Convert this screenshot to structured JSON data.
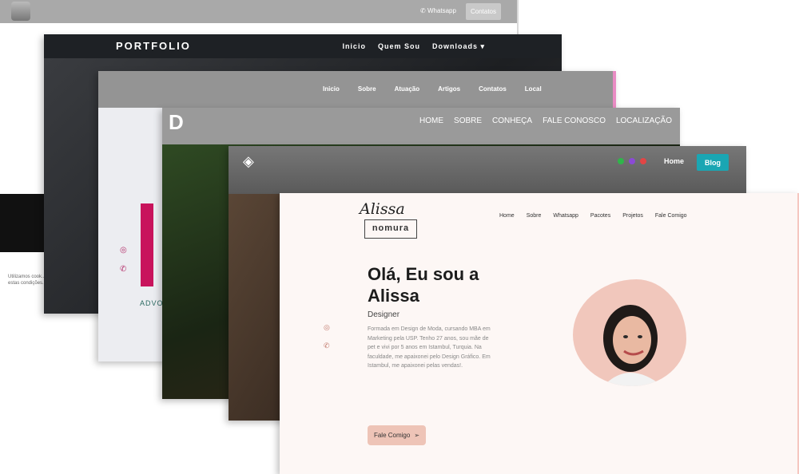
{
  "card1": {
    "whatsapp": "Whatsapp",
    "contact_button": "Contatos",
    "cookie_text": "Utilizamos cook... estas condições..."
  },
  "card2": {
    "brand": "PORTFOLIO",
    "nav": [
      "Inicio",
      "Quem Sou",
      "Downloads ▾"
    ]
  },
  "card3": {
    "nav": [
      "Inicio",
      "Sobre",
      "Atuação",
      "Artigos",
      "Contatos",
      "Local"
    ],
    "adv_text": "ADVO"
  },
  "card4": {
    "nav": [
      "HOME",
      "SOBRE",
      "CONHEÇA",
      "FALE CONOSCO",
      "LOCALIZAÇÃO"
    ]
  },
  "card5": {
    "home": "Home",
    "blog": "Blog",
    "social_colors": [
      "#2fb54a",
      "#8b4ad6",
      "#e24545"
    ]
  },
  "card6": {
    "logo_script": "Alissa",
    "logo_box": "nomura",
    "nav": [
      "Home",
      "Sobre",
      "Whatsapp",
      "Pacotes",
      "Projetos",
      "Fale Comigo"
    ],
    "headline": "Olá, Eu sou a Alissa",
    "role": "Designer",
    "description": "Formada em Design de Moda, cursando MBA em Marketing pela USP. Tenho 27 anos, sou mãe de pet e vivi por 5 anos em Istambul, Turquia. Na faculdade, me apaixonei pelo Design Gráfico. Em Istambul, me apaixonei pelas vendas!.",
    "cta": "Fale Comigo"
  }
}
